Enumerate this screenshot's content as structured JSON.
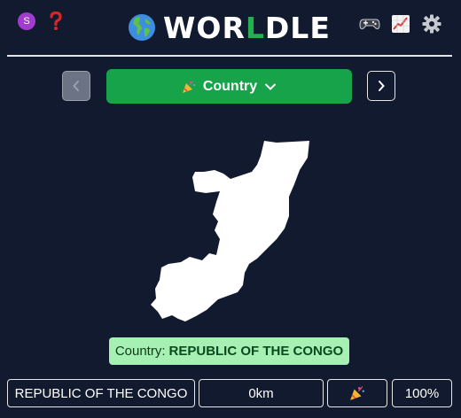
{
  "header": {
    "avatar_letter": "S",
    "help_icon": "question-mark-icon",
    "logo_globe_icon": "globe-icon",
    "title_before": "WOR",
    "title_accent": "L",
    "title_after": "DLE",
    "stats_icon": "chart-increasing-icon",
    "settings_icon": "gear-icon",
    "game_icon": "controller-icon"
  },
  "selector": {
    "label": "Country",
    "party_icon": "party-popper-icon",
    "chevron_icon": "chevron-down-icon"
  },
  "answer": {
    "prefix": "Country:",
    "value": "REPUBLIC OF THE CONGO"
  },
  "guess": {
    "country": "REPUBLIC OF THE CONGO",
    "distance": "0km",
    "direction_icon": "party-popper-icon",
    "proximity": "100%"
  },
  "colors": {
    "background": "#111a2e",
    "accent_green": "#16a34a",
    "answer_bg": "#a7f0b4",
    "avatar": "#a23ccf",
    "help": "#d42828"
  }
}
